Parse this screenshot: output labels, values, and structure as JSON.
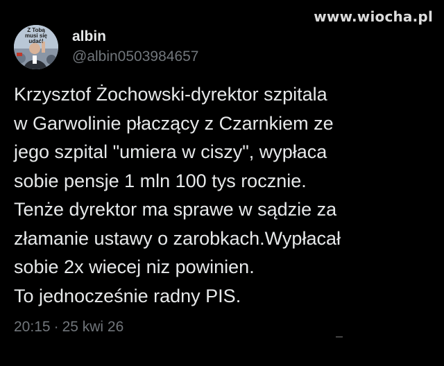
{
  "watermark": "www.wiocha.pl",
  "author": {
    "display_name": "albin",
    "handle": "@albin0503984657",
    "avatar_text": [
      "Z Tobą",
      "musi się",
      "udać!"
    ]
  },
  "tweet": {
    "lines": [
      "Krzysztof Żochowski-dyrektor szpitala",
      "w Garwolinie płaczący z Czarnkiem ze",
      "jego szpital \"umiera w ciszy\", wypłaca",
      "sobie pensje 1 mln 100 tys rocznie.",
      "Tenże dyrektor ma sprawe w sądzie za",
      "złamanie ustawy o zarobkach.Wypłacał",
      "sobie 2x wiecej niz powinien.",
      "To jednocześnie radny PIS."
    ],
    "time": "20:15",
    "separator": "·",
    "date": "25 kwi 26"
  },
  "colors": {
    "background": "#000000",
    "primary_text": "#e7e9ea",
    "secondary_text": "#71767b"
  }
}
